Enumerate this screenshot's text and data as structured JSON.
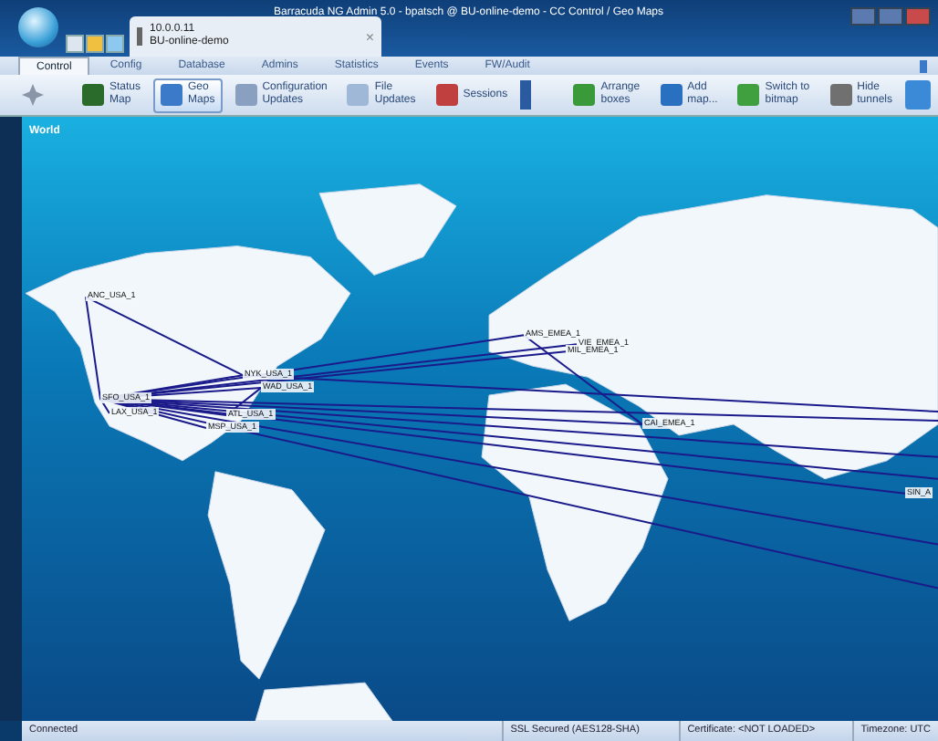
{
  "window": {
    "title": "Barracuda NG Admin 5.0  -  bpatsch @ BU-online-demo  -  CC Control / Geo Maps"
  },
  "session_tab": {
    "address": "10.0.0.11",
    "name": "BU-online-demo",
    "close": "×"
  },
  "tabs": [
    {
      "label": "Control",
      "selected": true
    },
    {
      "label": "Config",
      "selected": false
    },
    {
      "label": "Database",
      "selected": false
    },
    {
      "label": "Admins",
      "selected": false
    },
    {
      "label": "Statistics",
      "selected": false
    },
    {
      "label": "Events",
      "selected": false
    },
    {
      "label": "FW/Audit",
      "selected": false
    }
  ],
  "toolbar": {
    "left": [
      {
        "kind": "status",
        "lines": [
          "Status",
          "Map"
        ],
        "selected": false
      },
      {
        "kind": "geo",
        "lines": [
          "Geo",
          "Maps"
        ],
        "selected": true
      },
      {
        "kind": "config",
        "lines": [
          "Configuration",
          "Updates"
        ],
        "selected": false
      },
      {
        "kind": "file",
        "lines": [
          "File",
          "Updates"
        ],
        "selected": false
      },
      {
        "kind": "sessions",
        "lines": [
          "Sessions"
        ],
        "selected": false
      }
    ],
    "right": [
      {
        "kind": "arrange",
        "lines": [
          "Arrange",
          "boxes"
        ],
        "selected": false
      },
      {
        "kind": "add",
        "lines": [
          "Add",
          "map..."
        ],
        "selected": false
      },
      {
        "kind": "switch",
        "lines": [
          "Switch to",
          "bitmap"
        ],
        "selected": false
      },
      {
        "kind": "hide",
        "lines": [
          "Hide",
          "tunnels"
        ],
        "selected": false
      }
    ]
  },
  "map": {
    "title": "World",
    "nodes": [
      {
        "label": "ANC_USA_1"
      },
      {
        "label": "NYK_USA_1"
      },
      {
        "label": "WAD_USA_1"
      },
      {
        "label": "SFO_USA_1"
      },
      {
        "label": "LAX_USA_1"
      },
      {
        "label": "ATL_USA_1"
      },
      {
        "label": "MSP_USA_1"
      },
      {
        "label": "AMS_EMEA_1"
      },
      {
        "label": "VIE_EMEA_1"
      },
      {
        "label": "MIL_EMEA_1"
      },
      {
        "label": "CAI_EMEA_1"
      },
      {
        "label": "SIN_A"
      }
    ]
  },
  "status_bar": [
    "Connected",
    "SSL Secured (AES128-SHA)",
    "Certificate: <NOT LOADED>",
    "Timezone: UTC"
  ]
}
